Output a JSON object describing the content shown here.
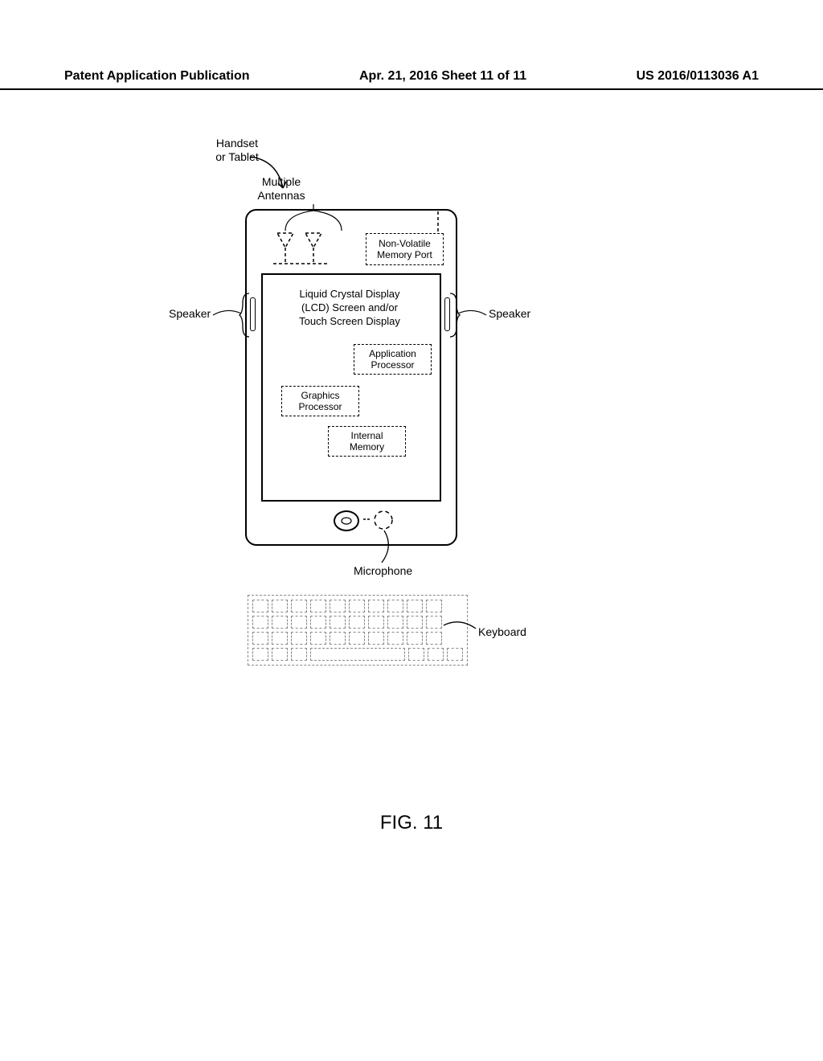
{
  "header": {
    "left": "Patent Application Publication",
    "center": "Apr. 21, 2016  Sheet 11 of 11",
    "right": "US 2016/0113036 A1"
  },
  "labels": {
    "handset": "Handset\nor Tablet",
    "antennas": "Multiple\nAntennas",
    "speaker_left": "Speaker",
    "speaker_right": "Speaker",
    "microphone": "Microphone",
    "keyboard": "Keyboard"
  },
  "blocks": {
    "nvm_port": "Non-Volatile\nMemory Port",
    "lcd": "Liquid Crystal Display\n(LCD) Screen and/or\nTouch Screen Display",
    "app_proc": "Application\nProcessor",
    "gfx_proc": "Graphics\nProcessor",
    "int_mem": "Internal\nMemory"
  },
  "figure_caption": "FIG. 11"
}
